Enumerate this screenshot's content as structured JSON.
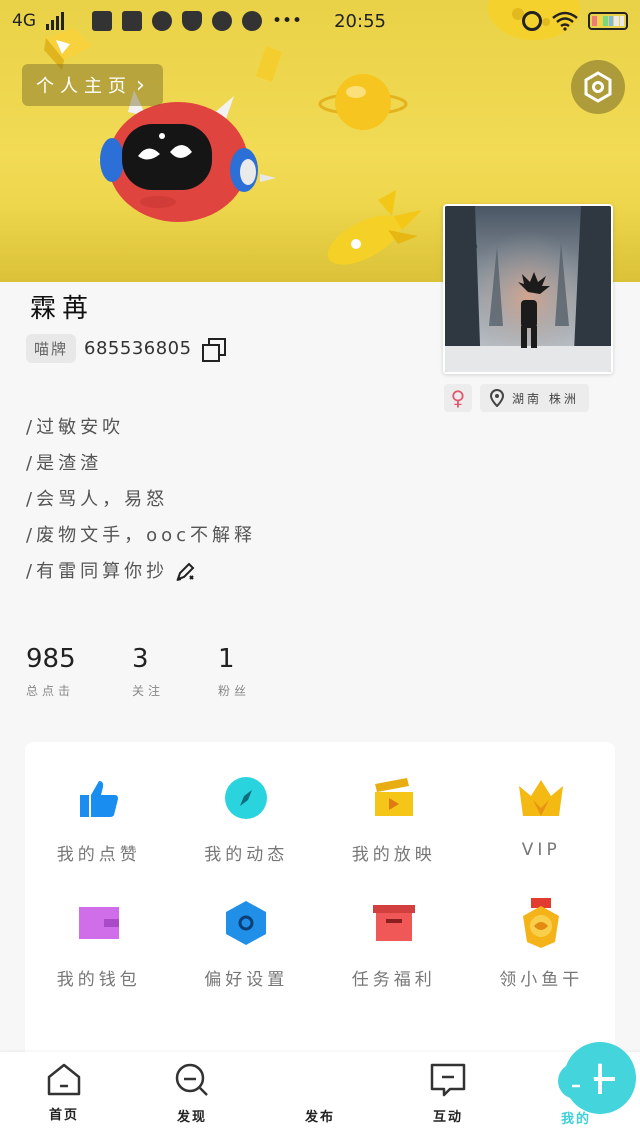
{
  "status_bar": {
    "network": "4G",
    "time": "20:55"
  },
  "header": {
    "homepage_label": "个人主页",
    "homepage_chevron": "›"
  },
  "profile": {
    "name": "霖苒",
    "id_tag": "喵牌",
    "id_number": "685536805",
    "gender_symbol": "♀",
    "location": "湖南 株洲",
    "bio": [
      "/过敏安吹",
      "/是渣渣",
      "/会骂人，易怒",
      "/废物文手，ooc不解释",
      "/有雷同算你抄"
    ]
  },
  "stats": [
    {
      "value": "985",
      "label": "总点击"
    },
    {
      "value": "3",
      "label": "关注"
    },
    {
      "value": "1",
      "label": "粉丝"
    }
  ],
  "menu": [
    {
      "label": "我的点赞",
      "icon": "thumbs-up-icon",
      "color": "#1a8ef0"
    },
    {
      "label": "我的动态",
      "icon": "compass-icon",
      "color": "#2ad4de"
    },
    {
      "label": "我的放映",
      "icon": "clapper-icon",
      "color": "#f5c518"
    },
    {
      "label": "VIP",
      "icon": "crown-icon",
      "color": "#f5b914"
    },
    {
      "label": "我的钱包",
      "icon": "wallet-icon",
      "color": "#cf6ee8"
    },
    {
      "label": "偏好设置",
      "icon": "hexagon-gear-icon",
      "color": "#1f8fe8"
    },
    {
      "label": "任务福利",
      "icon": "gift-box-icon",
      "color": "#f05757"
    },
    {
      "label": "领小鱼干",
      "icon": "medal-icon",
      "color": "#f5b31a"
    }
  ],
  "bottom_nav": [
    {
      "label": "首页",
      "icon": "home-icon"
    },
    {
      "label": "发现",
      "icon": "search-icon"
    },
    {
      "label": "发布",
      "icon": "plus-icon"
    },
    {
      "label": "互动",
      "icon": "chat-icon"
    },
    {
      "label": "我的",
      "icon": "profile-icon"
    }
  ],
  "colors": {
    "banner": "#f0d84e",
    "accent": "#44d4dc"
  }
}
